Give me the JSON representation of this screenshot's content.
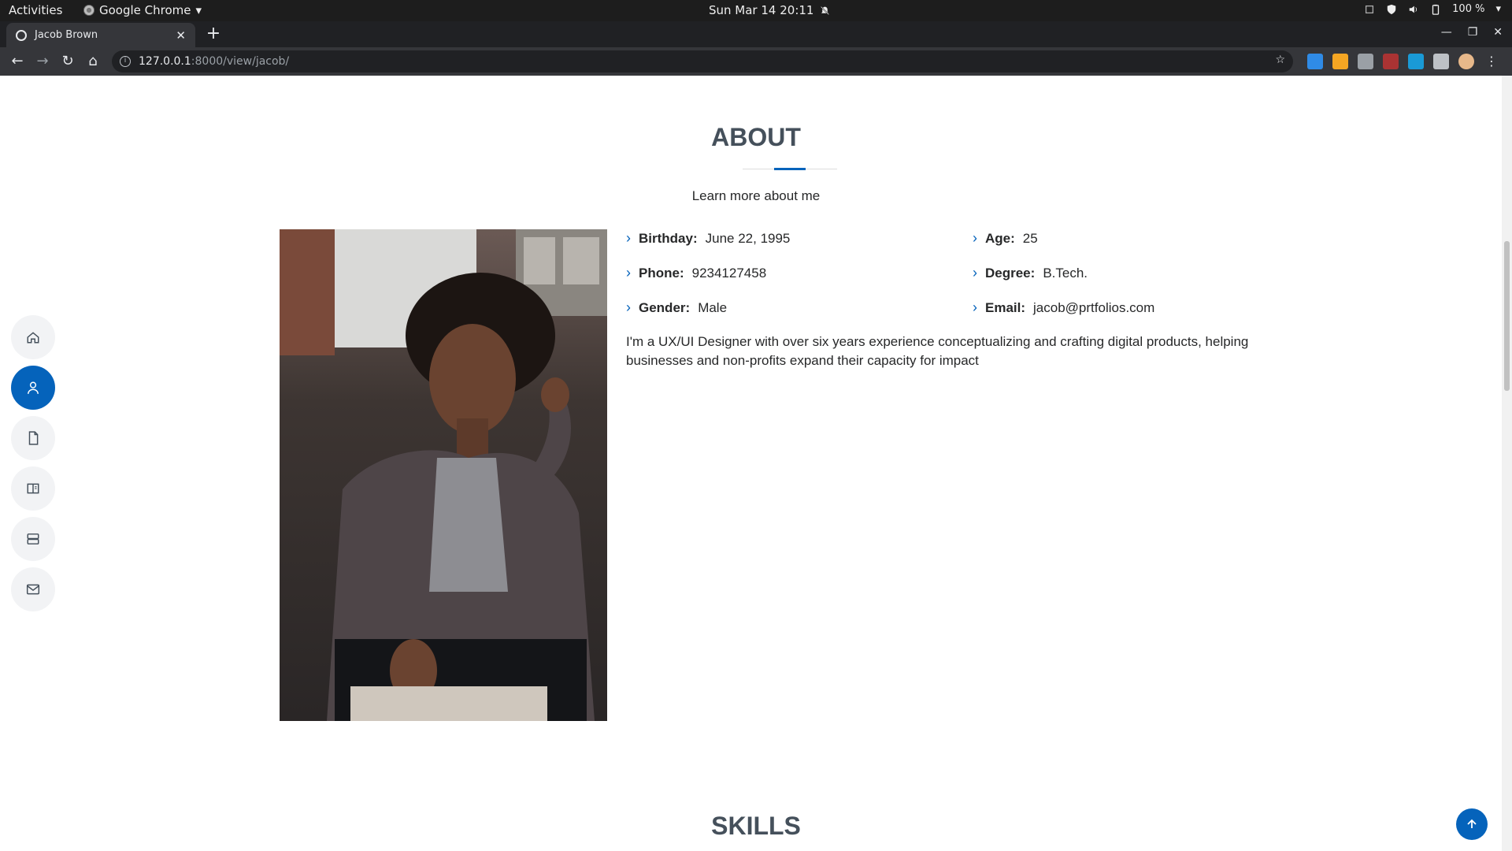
{
  "system_bar": {
    "activities": "Activities",
    "app_name": "Google Chrome",
    "clock": "Sun Mar 14  20:11",
    "battery": "100 %"
  },
  "browser": {
    "tab_title": "Jacob Brown",
    "url_host": "127.0.0.1",
    "url_path": ":8000/view/jacob/"
  },
  "side_nav": {
    "items": [
      {
        "icon": "home-icon"
      },
      {
        "icon": "person-icon",
        "active": true
      },
      {
        "icon": "file-icon"
      },
      {
        "icon": "book-icon"
      },
      {
        "icon": "server-icon"
      },
      {
        "icon": "envelope-icon"
      }
    ]
  },
  "about": {
    "title": "ABOUT",
    "subtitle": "Learn more about me",
    "fields": {
      "birthday": {
        "label": "Birthday:",
        "value": "June 22, 1995"
      },
      "age": {
        "label": "Age:",
        "value": "25"
      },
      "phone": {
        "label": "Phone:",
        "value": "9234127458"
      },
      "degree": {
        "label": "Degree:",
        "value": "B.Tech."
      },
      "gender": {
        "label": "Gender:",
        "value": "Male"
      },
      "email": {
        "label": "Email:",
        "value": "jacob@prtfolios.com"
      }
    },
    "bio": "I'm a UX/UI Designer with over six years experience conceptualizing and crafting digital products, helping businesses and non-profits expand their capacity for impact"
  },
  "skills": {
    "title": "SKILLS"
  },
  "colors": {
    "accent": "#0563bb",
    "heading": "#45505b",
    "text": "#272829"
  }
}
